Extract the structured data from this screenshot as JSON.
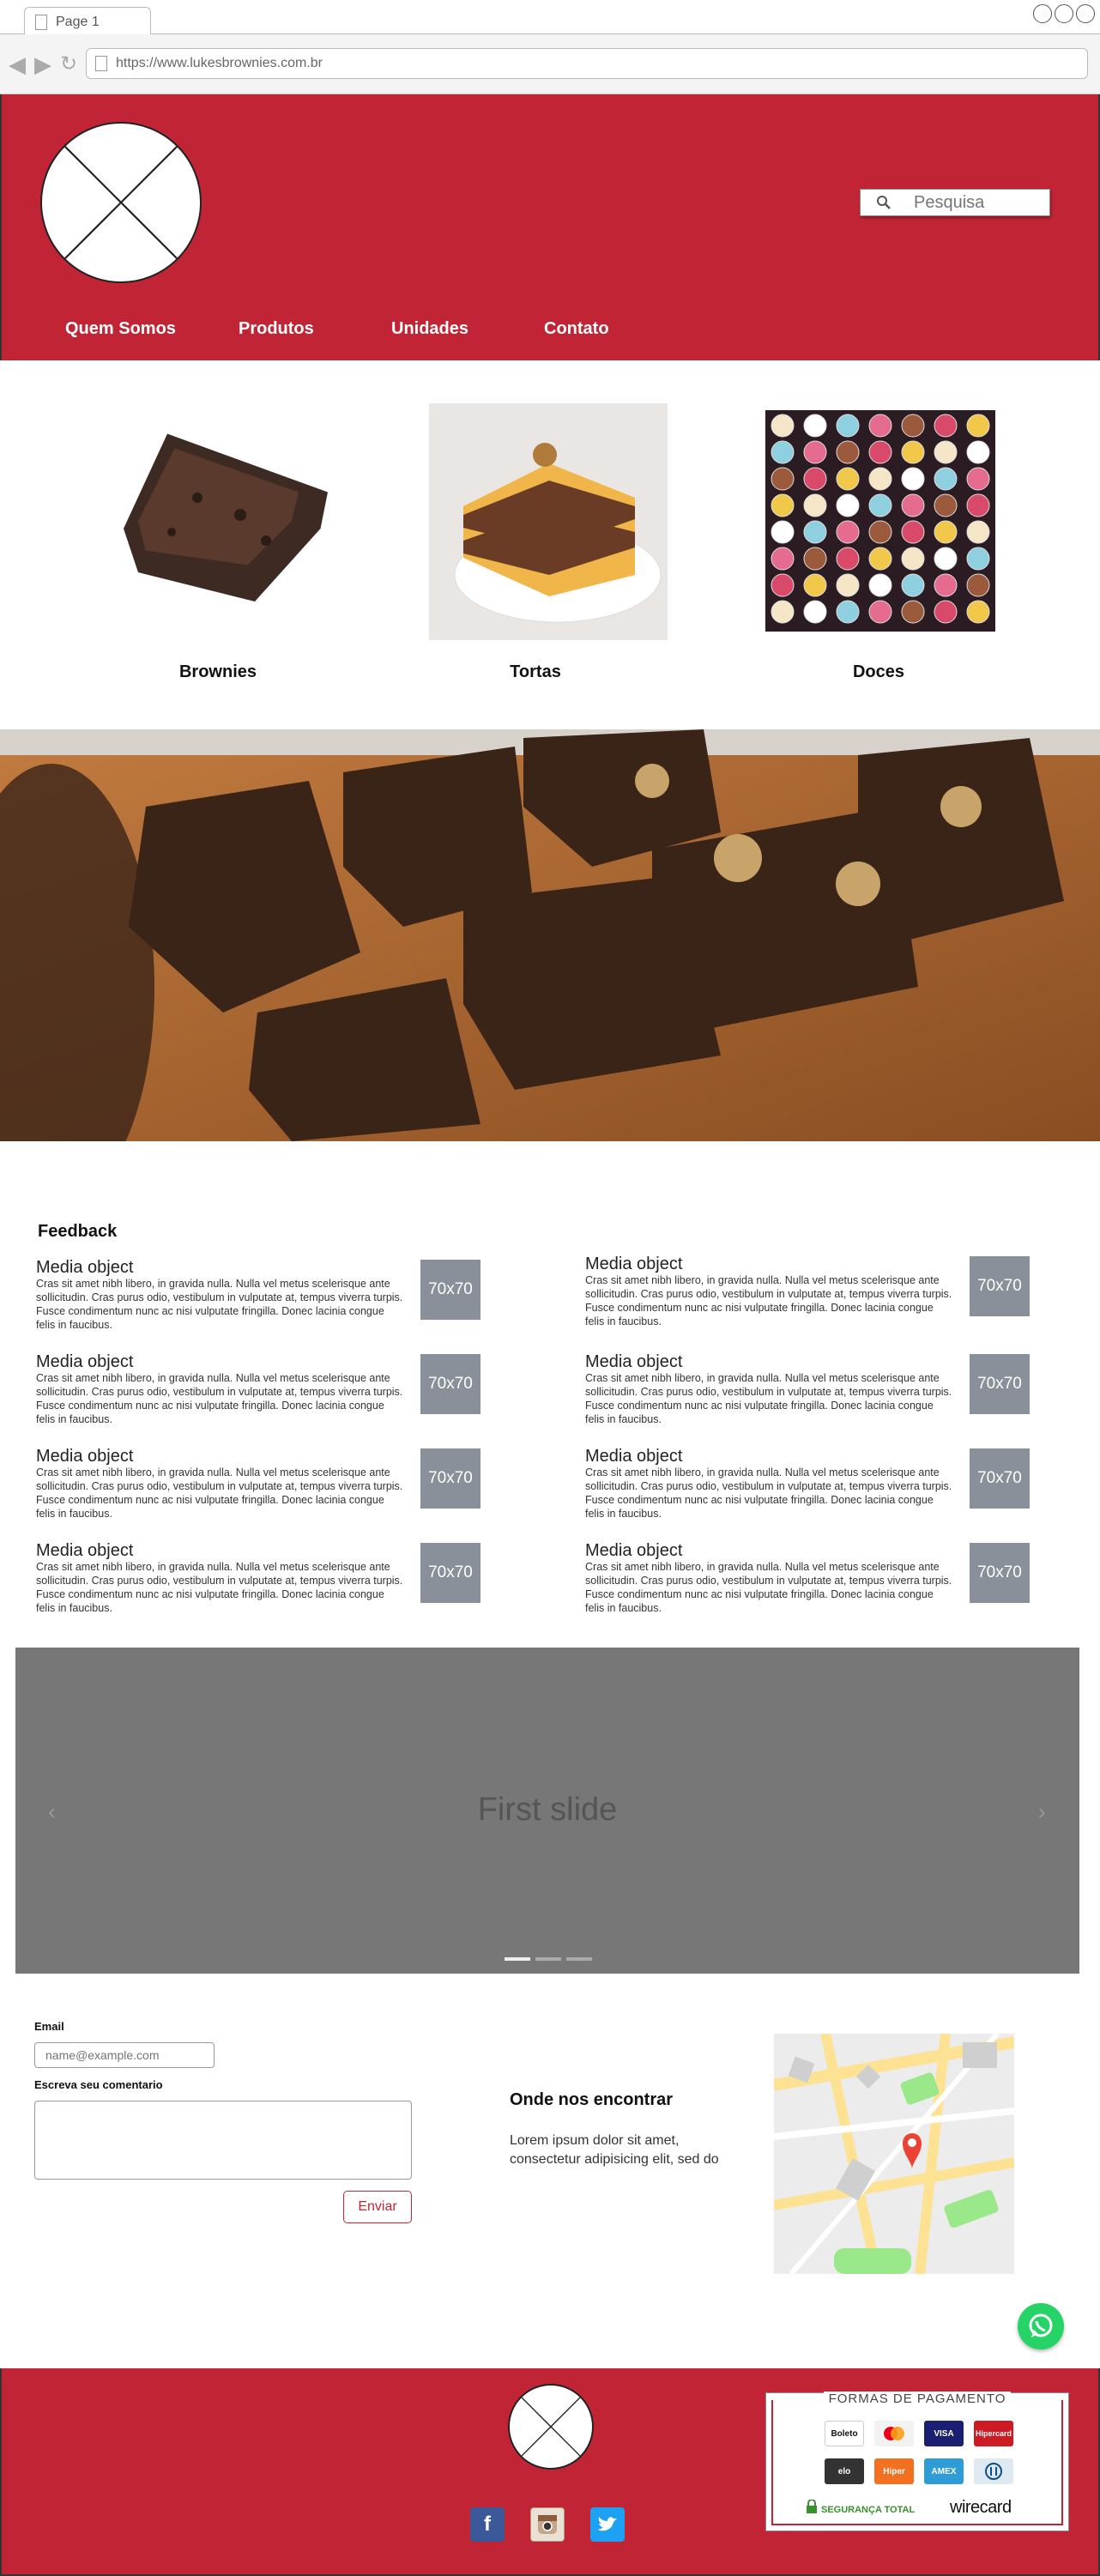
{
  "browser": {
    "tab_title": "Page 1",
    "url": "https://www.lukesbrownies.com.br"
  },
  "header": {
    "search_placeholder": "Pesquisa",
    "nav": [
      "Quem Somos",
      "Produtos",
      "Unidades",
      "Contato"
    ]
  },
  "products": [
    {
      "label": "Brownies",
      "image": "brownie-piece"
    },
    {
      "label": "Tortas",
      "image": "cake-slice"
    },
    {
      "label": "Doces",
      "image": "candy-box"
    }
  ],
  "hero": {
    "image": "brownies-on-board"
  },
  "feedback": {
    "title": "Feedback",
    "items": [
      {
        "heading": "Media object",
        "body": "Cras sit amet nibh libero, in gravida nulla. Nulla vel metus scelerisque ante sollicitudin. Cras purus odio, vestibulum in vulputate at, tempus viverra turpis. Fusce condimentum nunc ac nisi vulputate fringilla. Donec lacinia congue felis in faucibus.",
        "thumb": "70x70"
      },
      {
        "heading": "Media object",
        "body": "Cras sit amet nibh libero, in gravida nulla. Nulla vel metus scelerisque ante sollicitudin. Cras purus odio, vestibulum in vulputate at, tempus viverra turpis. Fusce condimentum nunc ac nisi vulputate fringilla. Donec lacinia congue felis in faucibus.",
        "thumb": "70x70"
      },
      {
        "heading": "Media object",
        "body": "Cras sit amet nibh libero, in gravida nulla. Nulla vel metus scelerisque ante sollicitudin. Cras purus odio, vestibulum in vulputate at, tempus viverra turpis. Fusce condimentum nunc ac nisi vulputate fringilla. Donec lacinia congue felis in faucibus.",
        "thumb": "70x70"
      },
      {
        "heading": "Media object",
        "body": "Cras sit amet nibh libero, in gravida nulla. Nulla vel metus scelerisque ante sollicitudin. Cras purus odio, vestibulum in vulputate at, tempus viverra turpis. Fusce condimentum nunc ac nisi vulputate fringilla. Donec lacinia congue felis in faucibus.",
        "thumb": "70x70"
      },
      {
        "heading": "Media object",
        "body": "Cras sit amet nibh libero, in gravida nulla. Nulla vel metus scelerisque ante sollicitudin. Cras purus odio, vestibulum in vulputate at, tempus viverra turpis. Fusce condimentum nunc ac nisi vulputate fringilla. Donec lacinia congue felis in faucibus.",
        "thumb": "70x70"
      },
      {
        "heading": "Media object",
        "body": "Cras sit amet nibh libero, in gravida nulla. Nulla vel metus scelerisque ante sollicitudin. Cras purus odio, vestibulum in vulputate at, tempus viverra turpis. Fusce condimentum nunc ac nisi vulputate fringilla. Donec lacinia congue felis in faucibus.",
        "thumb": "70x70"
      },
      {
        "heading": "Media object",
        "body": "Cras sit amet nibh libero, in gravida nulla. Nulla vel metus scelerisque ante sollicitudin. Cras purus odio, vestibulum in vulputate at, tempus viverra turpis. Fusce condimentum nunc ac nisi vulputate fringilla. Donec lacinia congue felis in faucibus.",
        "thumb": "70x70"
      },
      {
        "heading": "Media object",
        "body": "Cras sit amet nibh libero, in gravida nulla. Nulla vel metus scelerisque ante sollicitudin. Cras purus odio, vestibulum in vulputate at, tempus viverra turpis. Fusce condimentum nunc ac nisi vulputate fringilla. Donec lacinia congue felis in faucibus.",
        "thumb": "70x70"
      }
    ]
  },
  "carousel": {
    "caption": "First slide",
    "prev_icon": "chevron-left-icon",
    "next_icon": "chevron-right-icon",
    "slides": 3,
    "active_slide": 1
  },
  "contact": {
    "email_label": "Email",
    "email_placeholder": "name@example.com",
    "comment_label": "Escreva seu comentario",
    "send_label": "Enviar",
    "find_us_title": "Onde nos encontrar",
    "find_us_text": "Lorem ipsum dolor sit amet, consectetur adipisicing elit, sed do"
  },
  "footer": {
    "payment_title": "FORMAS DE PAGAMENTO",
    "payment_methods": [
      "Boleto",
      "Mastercard",
      "VISA",
      "Hipercard",
      "elo",
      "Hiper",
      "AMEX",
      "Diners"
    ],
    "security_text": "SEGURANÇA TOTAL",
    "provider": "wirecard",
    "social": [
      "facebook-icon",
      "instagram-icon",
      "twitter-icon"
    ]
  },
  "colors": {
    "brand_red": "#c12535",
    "carousel_gray": "#777777",
    "thumb_gray": "#8a9099",
    "whatsapp_green": "#25d366"
  }
}
